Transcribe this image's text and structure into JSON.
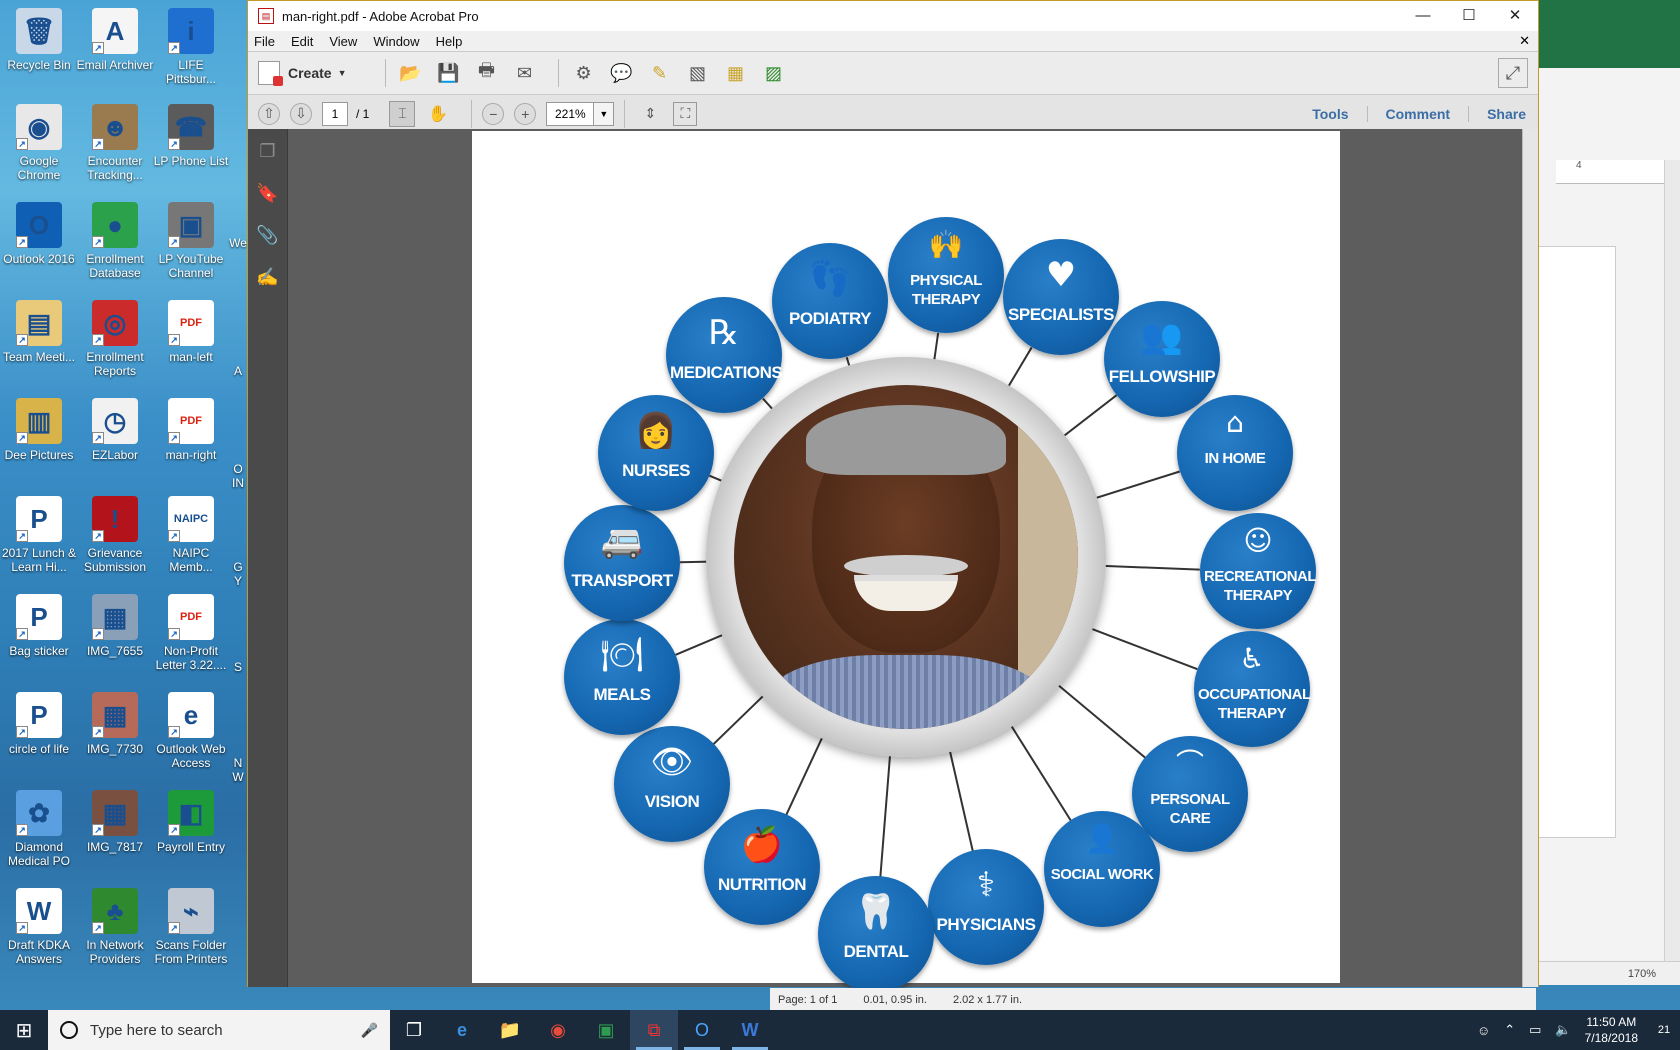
{
  "desktop": {
    "icons": [
      {
        "label": "Recycle Bin",
        "glyph": "🗑",
        "color": "#c8d8e8"
      },
      {
        "label": "Email Archiver",
        "glyph": "A",
        "color": "#f5f5f5"
      },
      {
        "label": "LIFE Pittsbur...",
        "glyph": "i",
        "color": "#1e6fd0"
      },
      {
        "label": "Google Chrome",
        "glyph": "◉",
        "color": "#e8e8e8"
      },
      {
        "label": "Encounter Tracking...",
        "glyph": "☻",
        "color": "#9a7b4f"
      },
      {
        "label": "LP Phone List",
        "glyph": "☎",
        "color": "#5b5b5b"
      },
      {
        "label": "Outlook 2016",
        "glyph": "O",
        "color": "#0f5fb5"
      },
      {
        "label": "Enrollment Database",
        "glyph": "●",
        "color": "#2aa14a"
      },
      {
        "label": "LP YouTube Channel",
        "glyph": "▣",
        "color": "#777"
      },
      {
        "label": "Team Meeti...",
        "glyph": "▤",
        "color": "#e9c97a"
      },
      {
        "label": "Enrollment Reports",
        "glyph": "◎",
        "color": "#cc2b2b"
      },
      {
        "label": "man-left",
        "glyph": "PDF",
        "color": "#ffffff"
      },
      {
        "label": "Dee Pictures",
        "glyph": "▥",
        "color": "#d8b34a"
      },
      {
        "label": "EZLabor",
        "glyph": "◷",
        "color": "#f1f1f1"
      },
      {
        "label": "man-right",
        "glyph": "PDF",
        "color": "#ffffff"
      },
      {
        "label": "2017 Lunch & Learn Hi...",
        "glyph": "P",
        "color": "#ffffff"
      },
      {
        "label": "Grievance Submission",
        "glyph": "!",
        "color": "#b3141c"
      },
      {
        "label": "NAIPC Memb...",
        "glyph": "NAIPC",
        "color": "#ffffff"
      },
      {
        "label": "Bag sticker",
        "glyph": "P",
        "color": "#ffffff"
      },
      {
        "label": "IMG_7655",
        "glyph": "▦",
        "color": "#8aa0b8"
      },
      {
        "label": "Non-Profit Letter 3.22....",
        "glyph": "PDF",
        "color": "#ffffff"
      },
      {
        "label": "circle of life",
        "glyph": "P",
        "color": "#ffffff"
      },
      {
        "label": "IMG_7730",
        "glyph": "▦",
        "color": "#b56a5a"
      },
      {
        "label": "Outlook Web Access",
        "glyph": "e",
        "color": "#ffffff"
      },
      {
        "label": "Diamond Medical PO",
        "glyph": "✿",
        "color": "#5aa0e0"
      },
      {
        "label": "IMG_7817",
        "glyph": "▦",
        "color": "#7a5040"
      },
      {
        "label": "Payroll Entry",
        "glyph": "◧",
        "color": "#1d9b3a"
      },
      {
        "label": "Draft KDKA Answers",
        "glyph": "W",
        "color": "#ffffff"
      },
      {
        "label": "In Network Providers",
        "glyph": "♣",
        "color": "#2f8a2f"
      },
      {
        "label": "Scans Folder From Printers",
        "glyph": "⌁",
        "color": "#c0c8d4"
      }
    ],
    "partial_labels": [
      "We",
      "A",
      "O IN",
      "G Y",
      "S",
      "N W"
    ]
  },
  "bg_window": {
    "ruler_text": "4",
    "zoom": "170%"
  },
  "acrobat": {
    "title": "man-right.pdf - Adobe Acrobat Pro",
    "menu": [
      "File",
      "Edit",
      "View",
      "Window",
      "Help"
    ],
    "create_label": "Create",
    "page_current": "1",
    "page_total": "/ 1",
    "zoom": "221%",
    "right_links": [
      "Tools",
      "Comment",
      "Share"
    ],
    "status": {
      "page": "Page: 1 of 1",
      "cursor": "0.01, 0.95 in.",
      "size": "2.02 x 1.77 in."
    }
  },
  "diagram": {
    "services": [
      {
        "label": "PHYSICAL THERAPY",
        "glyph": "🙌"
      },
      {
        "label": "SPECIALISTS",
        "glyph": "♥"
      },
      {
        "label": "FELLOWSHIP",
        "glyph": "👥"
      },
      {
        "label": "IN HOME",
        "glyph": "⌂"
      },
      {
        "label": "RECREATIONAL THERAPY",
        "glyph": "☺"
      },
      {
        "label": "OCCUPATIONAL THERAPY",
        "glyph": "♿"
      },
      {
        "label": "PERSONAL CARE",
        "glyph": "⌒"
      },
      {
        "label": "SOCIAL WORK",
        "glyph": "👤"
      },
      {
        "label": "PHYSICIANS",
        "glyph": "⚕"
      },
      {
        "label": "DENTAL",
        "glyph": "🦷"
      },
      {
        "label": "NUTRITION",
        "glyph": "🍎"
      },
      {
        "label": "VISION",
        "glyph": "👁"
      },
      {
        "label": "MEALS",
        "glyph": "🍽"
      },
      {
        "label": "TRANSPORT",
        "glyph": "🚐"
      },
      {
        "label": "NURSES",
        "glyph": "👩"
      },
      {
        "label": "MEDICATIONS",
        "glyph": "℞"
      },
      {
        "label": "PODIATRY",
        "glyph": "👣"
      }
    ]
  },
  "taskbar": {
    "search_placeholder": "Type here to search",
    "apps": [
      "task-view",
      "edge",
      "file-explorer",
      "chrome",
      "project",
      "acrobat",
      "outlook",
      "word"
    ],
    "time": "11:50 AM",
    "date": "7/18/2018",
    "notifications": "21"
  }
}
